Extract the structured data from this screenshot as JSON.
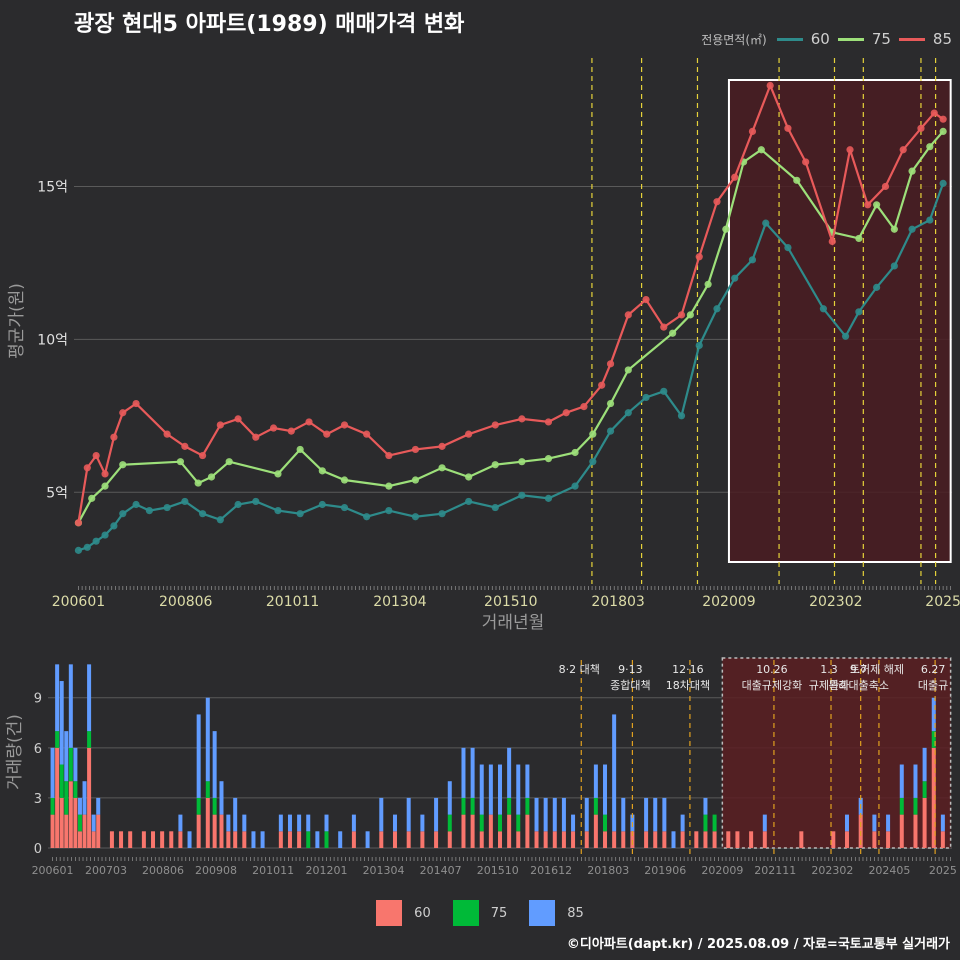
{
  "title": "광장 현대5 아파트(1989) 매매가격 변화",
  "legend_top": {
    "title": "전용면적(㎡)",
    "items": [
      {
        "label": "60",
        "color": "#2e8b8b"
      },
      {
        "label": "75",
        "color": "#9de07a"
      },
      {
        "label": "85",
        "color": "#e85a5a"
      }
    ]
  },
  "legend_bottom": {
    "items": [
      {
        "label": "60",
        "color": "#f8766d"
      },
      {
        "label": "75",
        "color": "#00ba38"
      },
      {
        "label": "85",
        "color": "#619cff"
      }
    ]
  },
  "footer": "©디아파트(dapt.kr) / 2025.08.09 / 자료=국토교통부 실거래가",
  "chart_data": [
    {
      "type": "line",
      "title": "광장 현대5 아파트(1989) 매매가격 변화",
      "xlabel": "거래년월",
      "ylabel": "평균가(원)",
      "x_ticks": [
        "200601",
        "200806",
        "201011",
        "201304",
        "201510",
        "201803",
        "202009",
        "202302",
        "2025"
      ],
      "x_tick_decimal": [
        2006.0,
        2008.42,
        2010.83,
        2013.25,
        2015.75,
        2018.17,
        2020.67,
        2023.08,
        2025.5
      ],
      "xlim": [
        2005.9,
        2025.7
      ],
      "y_ticks": [
        {
          "value": 5,
          "label": "5억"
        },
        {
          "value": 10,
          "label": "10억"
        },
        {
          "value": 15,
          "label": "15억"
        }
      ],
      "ylim": [
        2.0,
        19.2
      ],
      "y_unit": "억",
      "grid": true,
      "policy_lines": [
        2017.58,
        2018.7,
        2019.96,
        2021.8,
        2023.05,
        2023.7,
        2025.0,
        2025.33
      ],
      "highlight_range": [
        2020.67,
        2025.67
      ],
      "series": [
        {
          "name": "60",
          "color": "#2e8b8b",
          "x": [
            2006.0,
            2006.2,
            2006.4,
            2006.6,
            2006.8,
            2007.0,
            2007.3,
            2007.6,
            2008.0,
            2008.4,
            2008.8,
            2009.2,
            2009.6,
            2010.0,
            2010.5,
            2011.0,
            2011.5,
            2012.0,
            2012.5,
            2013.0,
            2013.6,
            2014.2,
            2014.8,
            2015.4,
            2016.0,
            2016.6,
            2017.2,
            2017.6,
            2018.0,
            2018.4,
            2018.8,
            2019.2,
            2019.6,
            2020.0,
            2020.4,
            2020.8,
            2021.2,
            2021.5,
            2022.0,
            2022.8,
            2023.3,
            2023.6,
            2024.0,
            2024.4,
            2024.8,
            2025.2,
            2025.5
          ],
          "values": [
            3.1,
            3.2,
            3.4,
            3.6,
            3.9,
            4.3,
            4.6,
            4.4,
            4.5,
            4.7,
            4.3,
            4.1,
            4.6,
            4.7,
            4.4,
            4.3,
            4.6,
            4.5,
            4.2,
            4.4,
            4.2,
            4.3,
            4.7,
            4.5,
            4.9,
            4.8,
            5.2,
            6.0,
            7.0,
            7.6,
            8.1,
            8.3,
            7.5,
            9.8,
            11.0,
            12.0,
            12.6,
            13.8,
            13.0,
            11.0,
            10.1,
            10.9,
            11.7,
            12.4,
            13.6,
            13.9,
            15.1
          ]
        },
        {
          "name": "75",
          "color": "#9de07a",
          "x": [
            2006.0,
            2006.3,
            2006.6,
            2007.0,
            2008.3,
            2008.7,
            2009.0,
            2009.4,
            2010.5,
            2011.0,
            2011.5,
            2012.0,
            2013.0,
            2013.6,
            2014.2,
            2014.8,
            2015.4,
            2016.0,
            2016.6,
            2017.2,
            2017.6,
            2018.0,
            2018.4,
            2019.4,
            2019.8,
            2020.2,
            2020.6,
            2021.0,
            2021.4,
            2022.2,
            2023.0,
            2023.6,
            2024.0,
            2024.4,
            2024.8,
            2025.2,
            2025.5
          ],
          "values": [
            4.0,
            4.8,
            5.2,
            5.9,
            6.0,
            5.3,
            5.5,
            6.0,
            5.6,
            6.4,
            5.7,
            5.4,
            5.2,
            5.4,
            5.8,
            5.5,
            5.9,
            6.0,
            6.1,
            6.3,
            6.9,
            7.9,
            9.0,
            10.2,
            10.8,
            11.8,
            13.6,
            15.8,
            16.2,
            15.2,
            13.5,
            13.3,
            14.4,
            13.6,
            15.5,
            16.3,
            16.8
          ]
        },
        {
          "name": "85",
          "color": "#e85a5a",
          "x": [
            2006.0,
            2006.2,
            2006.4,
            2006.6,
            2006.8,
            2007.0,
            2007.3,
            2008.0,
            2008.4,
            2008.8,
            2009.2,
            2009.6,
            2010.0,
            2010.4,
            2010.8,
            2011.2,
            2011.6,
            2012.0,
            2012.5,
            2013.0,
            2013.6,
            2014.2,
            2014.8,
            2015.4,
            2016.0,
            2016.6,
            2017.0,
            2017.4,
            2017.8,
            2018.0,
            2018.4,
            2018.8,
            2019.2,
            2019.6,
            2020.0,
            2020.4,
            2020.8,
            2021.2,
            2021.6,
            2022.0,
            2022.4,
            2023.0,
            2023.4,
            2023.8,
            2024.2,
            2024.6,
            2025.0,
            2025.3,
            2025.5
          ],
          "values": [
            4.0,
            5.8,
            6.2,
            5.6,
            6.8,
            7.6,
            7.9,
            6.9,
            6.5,
            6.2,
            7.2,
            7.4,
            6.8,
            7.1,
            7.0,
            7.3,
            6.9,
            7.2,
            6.9,
            6.2,
            6.4,
            6.5,
            6.9,
            7.2,
            7.4,
            7.3,
            7.6,
            7.8,
            8.5,
            9.2,
            10.8,
            11.3,
            10.4,
            10.8,
            12.7,
            14.5,
            15.3,
            16.8,
            18.3,
            16.9,
            15.8,
            13.2,
            16.2,
            14.4,
            15.0,
            16.2,
            16.9,
            17.4,
            17.2
          ]
        }
      ]
    },
    {
      "type": "bar",
      "stacked": true,
      "ylabel": "거래량(건)",
      "y_ticks": [
        0,
        3,
        6,
        9
      ],
      "ylim": [
        0,
        11.5
      ],
      "x_ticks": [
        "200601",
        "200703",
        "200806",
        "200908",
        "201011",
        "201201",
        "201304",
        "201407",
        "201510",
        "201612",
        "201803",
        "201906",
        "202009",
        "202111",
        "202302",
        "202405",
        "2025"
      ],
      "x_tick_decimal": [
        2006.0,
        2007.17,
        2008.42,
        2009.58,
        2010.83,
        2012.0,
        2013.25,
        2014.5,
        2015.75,
        2016.92,
        2018.17,
        2019.42,
        2020.67,
        2021.83,
        2023.08,
        2024.33,
        2025.5
      ],
      "xlim": [
        2005.9,
        2025.7
      ],
      "highlight_range": [
        2020.67,
        2025.67
      ],
      "bar_colors": {
        "60": "#f8766d",
        "75": "#00ba38",
        "85": "#619cff"
      },
      "policy_lines": [
        {
          "x": 2017.58,
          "label": "8·2 대책",
          "style": "orange"
        },
        {
          "x": 2018.7,
          "label": "9·13\n종합대책",
          "style": "orange"
        },
        {
          "x": 2019.96,
          "label": "12·16\n18차대책",
          "style": "orange"
        },
        {
          "x": 2021.8,
          "label": "10.26\n대출규제강화",
          "style": "orange"
        },
        {
          "x": 2023.05,
          "label": "1.3\n규제완화",
          "style": "orange"
        },
        {
          "x": 2023.7,
          "label": "9.7\n특례대출축소",
          "style": "orange"
        },
        {
          "x": 2024.1,
          "label": "토허제 해제",
          "style": "orange"
        },
        {
          "x": 2025.33,
          "label": "6.27\n대출규",
          "style": "orange"
        }
      ],
      "bars": [
        {
          "x": 2006.0,
          "values": [
            2,
            1,
            3
          ]
        },
        {
          "x": 2006.1,
          "values": [
            6,
            1,
            4
          ]
        },
        {
          "x": 2006.2,
          "values": [
            3,
            2,
            5
          ]
        },
        {
          "x": 2006.3,
          "values": [
            2,
            2,
            3
          ]
        },
        {
          "x": 2006.4,
          "values": [
            4,
            2,
            5
          ]
        },
        {
          "x": 2006.5,
          "values": [
            3,
            1,
            2
          ]
        },
        {
          "x": 2006.6,
          "values": [
            1,
            1,
            1
          ]
        },
        {
          "x": 2006.7,
          "values": [
            2,
            0,
            2
          ]
        },
        {
          "x": 2006.8,
          "values": [
            6,
            1,
            4
          ]
        },
        {
          "x": 2006.9,
          "values": [
            1,
            0,
            1
          ]
        },
        {
          "x": 2007.0,
          "values": [
            2,
            0,
            1
          ]
        },
        {
          "x": 2007.3,
          "values": [
            1,
            0,
            0
          ]
        },
        {
          "x": 2007.5,
          "values": [
            1,
            0,
            0
          ]
        },
        {
          "x": 2007.7,
          "values": [
            1,
            0,
            0
          ]
        },
        {
          "x": 2008.0,
          "values": [
            1,
            0,
            0
          ]
        },
        {
          "x": 2008.2,
          "values": [
            1,
            0,
            0
          ]
        },
        {
          "x": 2008.4,
          "values": [
            1,
            0,
            0
          ]
        },
        {
          "x": 2008.6,
          "values": [
            1,
            0,
            0
          ]
        },
        {
          "x": 2008.8,
          "values": [
            1,
            0,
            1
          ]
        },
        {
          "x": 2009.0,
          "values": [
            0,
            0,
            1
          ]
        },
        {
          "x": 2009.2,
          "values": [
            2,
            1,
            5
          ]
        },
        {
          "x": 2009.4,
          "values": [
            3,
            1,
            5
          ]
        },
        {
          "x": 2009.55,
          "values": [
            2,
            1,
            4
          ]
        },
        {
          "x": 2009.7,
          "values": [
            2,
            0,
            2
          ]
        },
        {
          "x": 2009.85,
          "values": [
            1,
            0,
            1
          ]
        },
        {
          "x": 2010.0,
          "values": [
            1,
            0,
            2
          ]
        },
        {
          "x": 2010.2,
          "values": [
            1,
            0,
            1
          ]
        },
        {
          "x": 2010.4,
          "values": [
            0,
            0,
            1
          ]
        },
        {
          "x": 2010.6,
          "values": [
            0,
            0,
            1
          ]
        },
        {
          "x": 2011.0,
          "values": [
            1,
            0,
            1
          ]
        },
        {
          "x": 2011.2,
          "values": [
            1,
            0,
            1
          ]
        },
        {
          "x": 2011.4,
          "values": [
            1,
            0,
            1
          ]
        },
        {
          "x": 2011.6,
          "values": [
            0,
            1,
            1
          ]
        },
        {
          "x": 2011.8,
          "values": [
            0,
            0,
            1
          ]
        },
        {
          "x": 2012.0,
          "values": [
            0,
            1,
            1
          ]
        },
        {
          "x": 2012.3,
          "values": [
            0,
            0,
            1
          ]
        },
        {
          "x": 2012.6,
          "values": [
            1,
            0,
            1
          ]
        },
        {
          "x": 2012.9,
          "values": [
            0,
            0,
            1
          ]
        },
        {
          "x": 2013.2,
          "values": [
            1,
            0,
            2
          ]
        },
        {
          "x": 2013.5,
          "values": [
            1,
            0,
            1
          ]
        },
        {
          "x": 2013.8,
          "values": [
            1,
            0,
            2
          ]
        },
        {
          "x": 2014.1,
          "values": [
            1,
            0,
            1
          ]
        },
        {
          "x": 2014.4,
          "values": [
            1,
            0,
            2
          ]
        },
        {
          "x": 2014.7,
          "values": [
            1,
            1,
            2
          ]
        },
        {
          "x": 2015.0,
          "values": [
            2,
            1,
            3
          ]
        },
        {
          "x": 2015.2,
          "values": [
            2,
            1,
            3
          ]
        },
        {
          "x": 2015.4,
          "values": [
            1,
            1,
            3
          ]
        },
        {
          "x": 2015.6,
          "values": [
            2,
            0,
            3
          ]
        },
        {
          "x": 2015.8,
          "values": [
            1,
            1,
            3
          ]
        },
        {
          "x": 2016.0,
          "values": [
            2,
            1,
            3
          ]
        },
        {
          "x": 2016.2,
          "values": [
            1,
            1,
            3
          ]
        },
        {
          "x": 2016.4,
          "values": [
            2,
            1,
            2
          ]
        },
        {
          "x": 2016.6,
          "values": [
            1,
            0,
            2
          ]
        },
        {
          "x": 2016.8,
          "values": [
            1,
            0,
            2
          ]
        },
        {
          "x": 2017.0,
          "values": [
            1,
            0,
            2
          ]
        },
        {
          "x": 2017.2,
          "values": [
            1,
            0,
            2
          ]
        },
        {
          "x": 2017.4,
          "values": [
            1,
            0,
            1
          ]
        },
        {
          "x": 2017.7,
          "values": [
            1,
            0,
            2
          ]
        },
        {
          "x": 2017.9,
          "values": [
            2,
            1,
            2
          ]
        },
        {
          "x": 2018.1,
          "values": [
            1,
            1,
            3
          ]
        },
        {
          "x": 2018.3,
          "values": [
            1,
            0,
            7
          ]
        },
        {
          "x": 2018.5,
          "values": [
            1,
            0,
            2
          ]
        },
        {
          "x": 2018.7,
          "values": [
            1,
            0,
            1
          ]
        },
        {
          "x": 2019.0,
          "values": [
            1,
            0,
            2
          ]
        },
        {
          "x": 2019.2,
          "values": [
            1,
            0,
            2
          ]
        },
        {
          "x": 2019.4,
          "values": [
            1,
            0,
            2
          ]
        },
        {
          "x": 2019.6,
          "values": [
            0,
            0,
            1
          ]
        },
        {
          "x": 2019.8,
          "values": [
            1,
            0,
            1
          ]
        },
        {
          "x": 2020.1,
          "values": [
            1,
            0,
            0
          ]
        },
        {
          "x": 2020.3,
          "values": [
            1,
            1,
            1
          ]
        },
        {
          "x": 2020.5,
          "values": [
            1,
            1,
            0
          ]
        },
        {
          "x": 2020.8,
          "values": [
            1,
            0,
            0
          ]
        },
        {
          "x": 2021.0,
          "values": [
            1,
            0,
            0
          ]
        },
        {
          "x": 2021.3,
          "values": [
            1,
            0,
            0
          ]
        },
        {
          "x": 2021.6,
          "values": [
            1,
            0,
            1
          ]
        },
        {
          "x": 2022.4,
          "values": [
            1,
            0,
            0
          ]
        },
        {
          "x": 2023.1,
          "values": [
            1,
            0,
            0
          ]
        },
        {
          "x": 2023.4,
          "values": [
            1,
            0,
            1
          ]
        },
        {
          "x": 2023.7,
          "values": [
            2,
            0,
            1
          ]
        },
        {
          "x": 2024.0,
          "values": [
            1,
            0,
            1
          ]
        },
        {
          "x": 2024.3,
          "values": [
            1,
            0,
            1
          ]
        },
        {
          "x": 2024.6,
          "values": [
            2,
            1,
            2
          ]
        },
        {
          "x": 2024.9,
          "values": [
            2,
            1,
            2
          ]
        },
        {
          "x": 2025.1,
          "values": [
            3,
            1,
            2
          ]
        },
        {
          "x": 2025.3,
          "values": [
            6,
            1,
            2
          ]
        },
        {
          "x": 2025.5,
          "values": [
            1,
            0,
            1
          ]
        }
      ]
    }
  ]
}
